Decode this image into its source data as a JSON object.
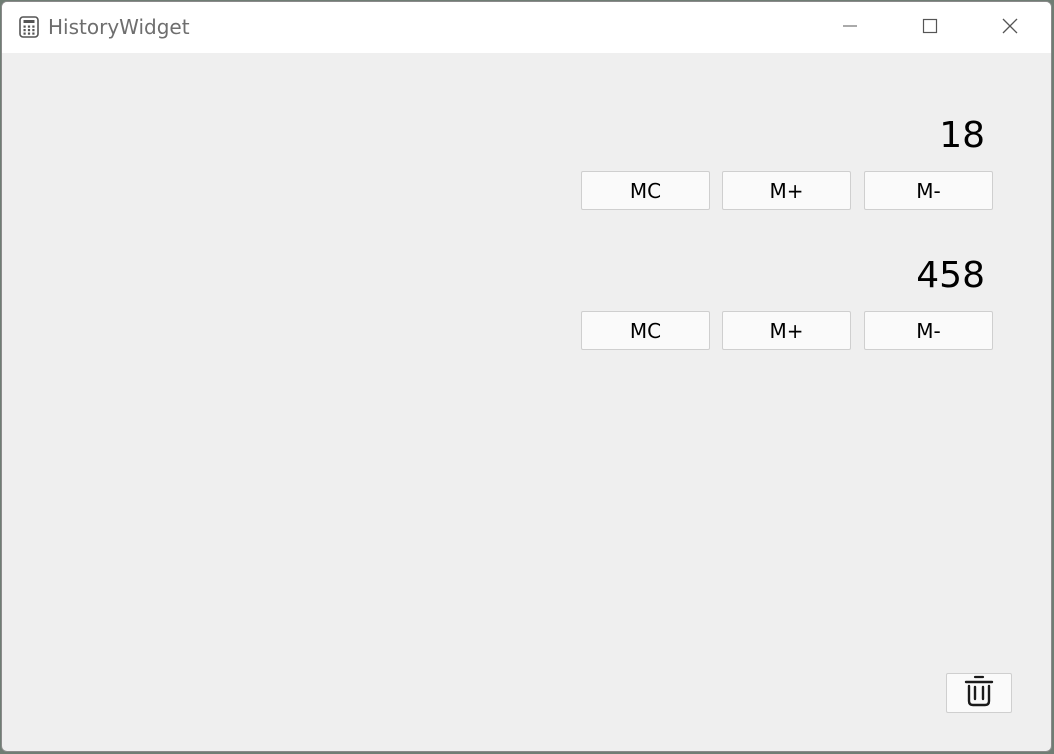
{
  "window": {
    "title": "HistoryWidget",
    "app_icon": "calculator-icon",
    "controls": {
      "minimize_icon": "minimize-icon",
      "maximize_icon": "maximize-icon",
      "close_icon": "close-icon"
    }
  },
  "memory": {
    "items": [
      {
        "value": "18",
        "buttons": {
          "clear": "MC",
          "add": "M+",
          "subtract": "M-"
        }
      },
      {
        "value": "458",
        "buttons": {
          "clear": "MC",
          "add": "M+",
          "subtract": "M-"
        }
      }
    ]
  },
  "footer": {
    "clear_all_icon": "trash-icon"
  },
  "colors": {
    "window_background": "#efefef",
    "titlebar_background": "#ffffff",
    "button_background": "#fafafa",
    "title_text": "#6e6e6e"
  }
}
